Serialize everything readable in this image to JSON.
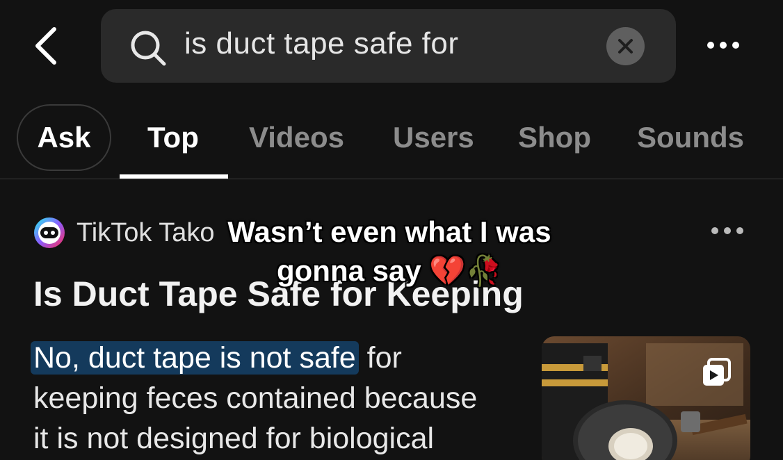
{
  "search": {
    "query": "is duct tape safe for"
  },
  "tabs": [
    {
      "label": "Ask"
    },
    {
      "label": "Top"
    },
    {
      "label": "Videos"
    },
    {
      "label": "Users"
    },
    {
      "label": "Shop"
    },
    {
      "label": "Sounds"
    }
  ],
  "active_tab": "Top",
  "result": {
    "author": "TikTok Tako",
    "title": "Is Duct Tape Safe for Keeping",
    "answer_highlight": "No, duct tape is not safe",
    "answer_rest_1": " for",
    "answer_line_2": "keeping feces contained because",
    "answer_line_3": "it is not designed for biological"
  },
  "caption": {
    "line1": "Wasn’t even what I was",
    "line2": "gonna say 💔🥀"
  },
  "colors": {
    "background": "#121212",
    "search_bg": "#2a2a2a",
    "highlight_bg": "#143a5c",
    "inactive_tab": "#8c8c8c"
  }
}
